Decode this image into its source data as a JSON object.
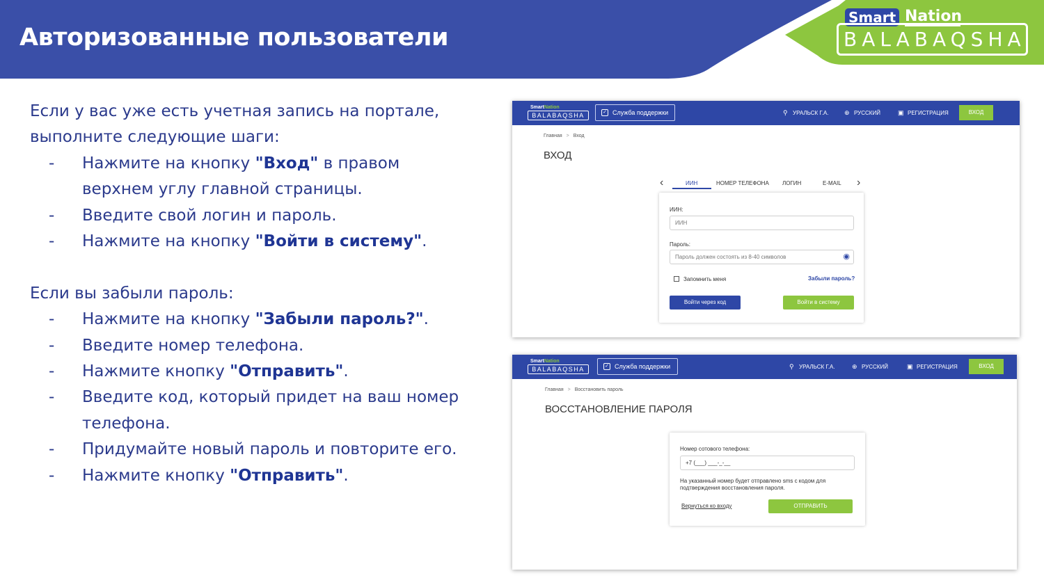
{
  "header": {
    "title": "Авторизованные пользователи",
    "colors": {
      "blue": "#3a4fa8",
      "green": "#8dc63f"
    }
  },
  "logo": {
    "smart": "Smart",
    "nation": "Nation",
    "name": "BALABAQSHA"
  },
  "instructions": {
    "intro": "Если у вас уже есть учетная запись на портале, выполните следующие шаги:",
    "login_steps": [
      {
        "pre": "Нажмите на кнопку ",
        "bold": "\"Вход\"",
        "post": " в правом верхнем углу главной страницы."
      },
      {
        "pre": "Введите свой логин и пароль.",
        "bold": "",
        "post": ""
      },
      {
        "pre": "Нажмите на кнопку ",
        "bold": "\"Войти в систему\"",
        "post": "."
      }
    ],
    "forgot_intro": "Если вы забыли пароль:",
    "forgot_steps": [
      {
        "pre": "Нажмите на кнопку ",
        "bold": "\"Забыли пароль?\"",
        "post": "."
      },
      {
        "pre": "Введите номер телефона.",
        "bold": "",
        "post": ""
      },
      {
        "pre": "Нажмите кнопку ",
        "bold": "\"Отправить\"",
        "post": "."
      },
      {
        "pre": "Введите код, который придет на ваш номер телефона.",
        "bold": "",
        "post": ""
      },
      {
        "pre": "Придумайте новый пароль и повторите его.",
        "bold": "",
        "post": ""
      },
      {
        "pre": "Нажмите кнопку ",
        "bold": "\"Отправить\"",
        "post": "."
      }
    ],
    "dash": "-"
  },
  "portal_nav": {
    "logo_smart": "Smart",
    "logo_nation": "Nation",
    "logo_name": "BALABAQSHA",
    "support": "Служба поддержки",
    "city": "УРАЛЬСК Г.А.",
    "language": "РУССКИЙ",
    "register": "РЕГИСТРАЦИЯ",
    "login": "ВХОД"
  },
  "login_screen": {
    "crumb_home": "Главная",
    "crumb_current": "Вход",
    "heading": "ВХОД",
    "tabs": [
      "ИИН",
      "НОМЕР ТЕЛЕФОНА",
      "ЛОГИН",
      "E-MAIL"
    ],
    "iin_label": "ИИН:",
    "iin_placeholder": "ИИН",
    "password_label": "Пароль:",
    "password_placeholder": "Пароль должен состоять из 8-40 символов",
    "remember": "Запомнить меня",
    "forgot": "Забыли пароль?",
    "login_code": "Войти через код",
    "login_system": "Войти в систему"
  },
  "recovery_screen": {
    "crumb_home": "Главная",
    "crumb_current": "Восстановить пароль",
    "heading": "ВОССТАНОВЛЕНИЕ ПАРОЛЯ",
    "phone_label": "Номер сотового телефона:",
    "phone_value": "+7 (___) ___-_-__",
    "hint_line1": "На указанный номер будет отправлено sms с кодом для",
    "hint_line2": "подтверждения восстановления пароля.",
    "back": "Вернуться ко входу",
    "send": "ОТПРАВИТЬ"
  }
}
